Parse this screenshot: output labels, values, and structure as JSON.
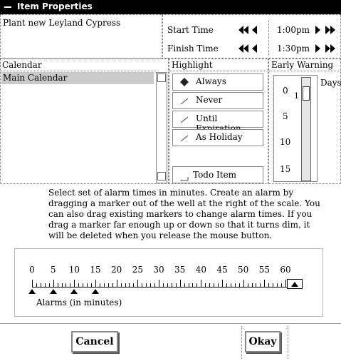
{
  "window": {
    "title": "Item Properties"
  },
  "item": {
    "name": "Plant new Leyland Cypress"
  },
  "times": {
    "start_label": "Start Time",
    "start_value": "1:00pm",
    "finish_label": "Finish Time",
    "finish_value": "1:30pm"
  },
  "calendar": {
    "header": "Calendar",
    "items": [
      "Main Calendar"
    ],
    "selected": "Main Calendar"
  },
  "highlight": {
    "header": "Highlight",
    "options": [
      "Always",
      "Never",
      "Until Expiration",
      "As Holiday"
    ],
    "selected": "Always",
    "todo_label": "Todo Item"
  },
  "early_warning": {
    "header": "Early Warning",
    "scale": [
      "0",
      "5",
      "10",
      "15"
    ],
    "value": "1",
    "unit": "Days"
  },
  "instructions": "Select set of alarm times in minutes. Create an alarm by dragging a marker out of the well at the right of the scale. You can also drag existing markers to change alarm times. If you drag a marker far enough up or down so that it turns dim, it will be deleted when you release the mouse button.",
  "alarms": {
    "scale_labels": [
      "0",
      "5",
      "10",
      "15",
      "20",
      "25",
      "30",
      "35",
      "40",
      "45",
      "50",
      "55",
      "60"
    ],
    "markers": [
      0,
      5,
      10,
      15
    ],
    "label": "Alarms (in minutes)"
  },
  "buttons": {
    "cancel": "Cancel",
    "okay": "Okay"
  }
}
